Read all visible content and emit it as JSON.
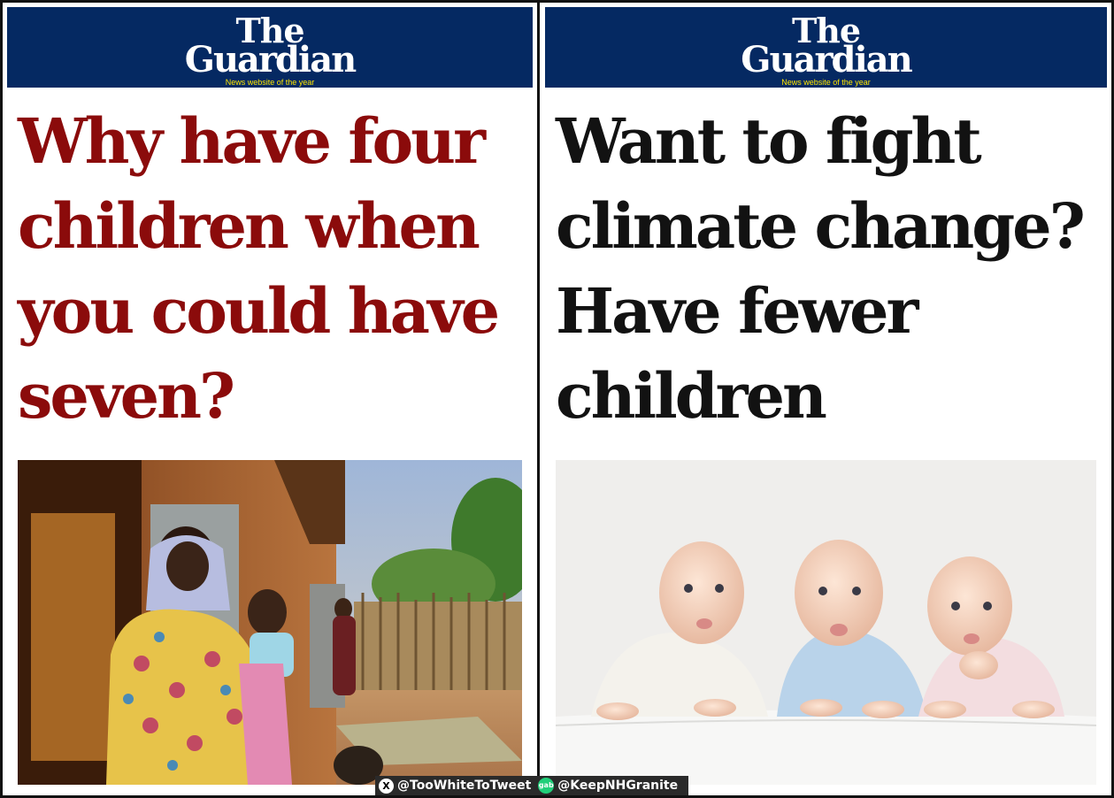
{
  "left_panel": {
    "masthead": {
      "brand_line1": "The",
      "brand_line2": "Guardian",
      "tagline": "News website of the year"
    },
    "headline": "Why have four\nchildren when\nyou could have\nseven?",
    "headline_color": "#8b0b0b",
    "photo_subject": "mother-holding-baby-outside-mud-house"
  },
  "right_panel": {
    "masthead": {
      "brand_line1": "The",
      "brand_line2": "Guardian",
      "tagline": "News website of the year"
    },
    "headline": "Want to fight\nclimate change?\nHave fewer\nchildren",
    "headline_color": "#121212",
    "photo_subject": "three-babies-lying-on-white-sheet"
  },
  "watermark": {
    "x_icon": "X",
    "x_handle": "@TooWhiteToTweet",
    "gab_icon": "gab",
    "gab_handle": "@KeepNHGranite"
  },
  "colors": {
    "masthead_blue": "#052962",
    "tagline_yellow": "#ffe500"
  }
}
